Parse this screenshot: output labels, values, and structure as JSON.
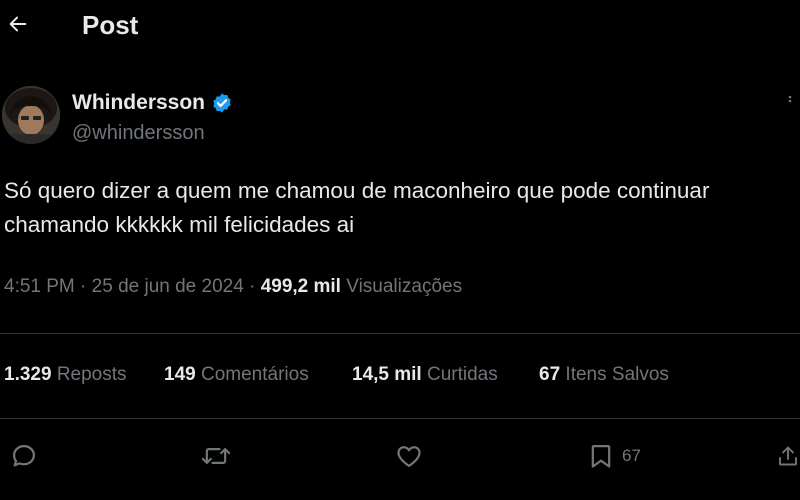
{
  "header": {
    "title": "Post"
  },
  "author": {
    "display_name": "Whindersson",
    "handle": "@whindersson",
    "verified": true
  },
  "tweet": {
    "text": "Só quero dizer a quem me chamou de maconheiro que pode continuar chamando kkkkkk mil felicidades ai"
  },
  "meta": {
    "time": "4:51 PM",
    "separator": "·",
    "date": "25 de jun de 2024",
    "views_count": "499,2 mil",
    "views_label": "Visualizações"
  },
  "stats": [
    {
      "count": "1.329",
      "label": "Reposts"
    },
    {
      "count": "149",
      "label": "Comentários"
    },
    {
      "count": "14,5 mil",
      "label": "Curtidas"
    },
    {
      "count": "67",
      "label": "Itens Salvos"
    }
  ],
  "actions": {
    "bookmark_count": "67"
  },
  "colors": {
    "background": "#000000",
    "text": "#e7e9ea",
    "muted": "#71767b",
    "divider": "#2f3336",
    "verified": "#1d9bf0"
  },
  "icons": [
    "back-arrow-icon",
    "verified-badge-icon",
    "more-icon",
    "reply-icon",
    "repost-icon",
    "like-icon",
    "bookmark-icon",
    "share-icon"
  ]
}
